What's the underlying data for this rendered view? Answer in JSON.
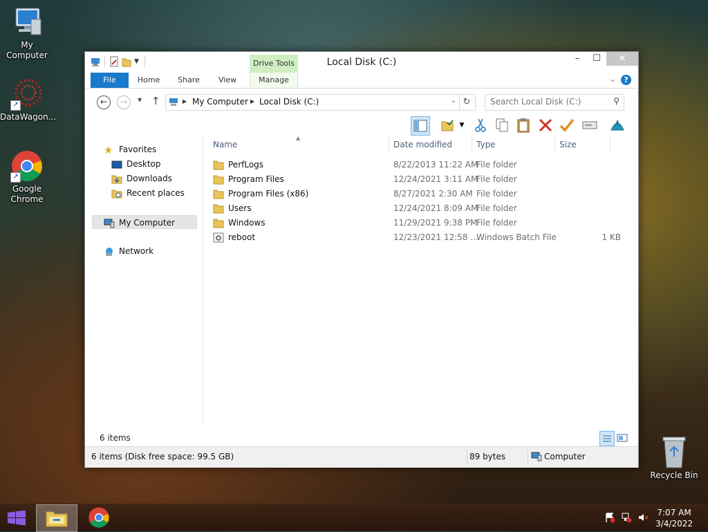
{
  "desktop": {
    "icons": [
      {
        "label": "My Computer"
      },
      {
        "label": "DataWagon..."
      },
      {
        "label": "Google Chrome"
      },
      {
        "label": "Recycle Bin"
      }
    ]
  },
  "window": {
    "title": "Local Disk (C:)",
    "context_tab_group": "Drive Tools",
    "ribbon_tabs": [
      "File",
      "Home",
      "Share",
      "View",
      "Manage"
    ],
    "address": {
      "crumbs": [
        "My Computer",
        "Local Disk (C:)"
      ]
    },
    "search": {
      "placeholder": "Search Local Disk (C:)"
    },
    "nav": {
      "favorites": "Favorites",
      "favorite_items": [
        "Desktop",
        "Downloads",
        "Recent places"
      ],
      "computer": "My Computer",
      "network": "Network"
    },
    "columns": [
      "Name",
      "Date modified",
      "Type",
      "Size"
    ],
    "files": [
      {
        "name": "PerfLogs",
        "date": "8/22/2013 11:22 AM",
        "type": "File folder",
        "size": "",
        "icon": "folder-icon"
      },
      {
        "name": "Program Files",
        "date": "12/24/2021 3:11 AM",
        "type": "File folder",
        "size": "",
        "icon": "folder-icon"
      },
      {
        "name": "Program Files (x86)",
        "date": "8/27/2021 2:30 AM",
        "type": "File folder",
        "size": "",
        "icon": "folder-icon"
      },
      {
        "name": "Users",
        "date": "12/24/2021 8:09 AM",
        "type": "File folder",
        "size": "",
        "icon": "folder-icon"
      },
      {
        "name": "Windows",
        "date": "11/29/2021 9:38 PM",
        "type": "File folder",
        "size": "",
        "icon": "folder-icon"
      },
      {
        "name": "reboot",
        "date": "12/23/2021 12:58 ...",
        "type": "Windows Batch File",
        "size": "1 KB",
        "icon": "batch-file-icon"
      }
    ],
    "items_count": "6 items",
    "status": {
      "left": "6 items (Disk free space: 99.5 GB)",
      "size": "89 bytes",
      "location": "Computer"
    }
  },
  "taskbar": {
    "time": "7:07 AM",
    "date": "3/4/2022"
  },
  "colors": {
    "file_tab": "#1979ca",
    "drive_tools": "#cfeec0",
    "selection": "#cde6f7",
    "folder": "#e8c45a"
  }
}
